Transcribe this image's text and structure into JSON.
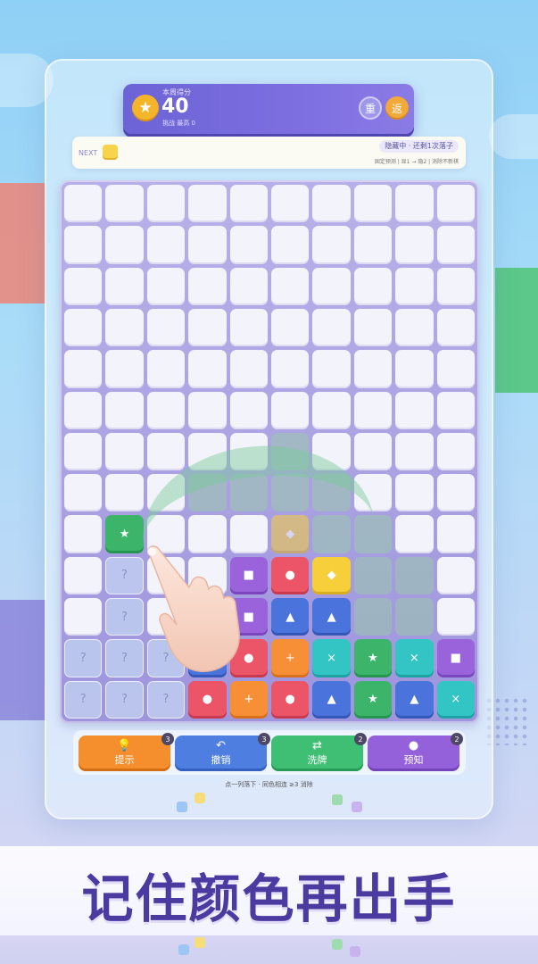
{
  "header": {
    "score_label": "本周得分",
    "score": "40",
    "sub": "挑战 最高 0",
    "restart_label": "重",
    "back_label": "返",
    "star_icon": "★"
  },
  "next": {
    "label": "NEXT",
    "chip_color": "yellow",
    "hidden_status": "隐藏中 · 还剩1次落子",
    "rules": "固定预测 | 显1 → 隐2 | 消除不新棋"
  },
  "board": {
    "cols": 10,
    "rows": 13,
    "grid": [
      "..........",
      "..........",
      "..........",
      "..........",
      "..........",
      "..........",
      ".....g....",
      "....ggg...",
      ".G..gYgg..",
      ".?..PRYgg.",
      ".?..PBBgg.",
      "???BRO CGCP",
      "???ROR BGBC"
    ],
    "cells": [
      {
        "r": 8,
        "c": 1,
        "color": "green",
        "sym": "★"
      },
      {
        "r": 8,
        "c": 5,
        "color": "yellow",
        "sym": "◆",
        "ghost": true
      },
      {
        "r": 9,
        "c": 1,
        "color": "hidden",
        "sym": "?"
      },
      {
        "r": 9,
        "c": 4,
        "color": "purple",
        "sym": "■"
      },
      {
        "r": 9,
        "c": 5,
        "color": "red",
        "sym": "●"
      },
      {
        "r": 9,
        "c": 6,
        "color": "yellow",
        "sym": "◆"
      },
      {
        "r": 10,
        "c": 1,
        "color": "hidden",
        "sym": "?"
      },
      {
        "r": 10,
        "c": 4,
        "color": "purple",
        "sym": "■"
      },
      {
        "r": 10,
        "c": 5,
        "color": "blue",
        "sym": "▲"
      },
      {
        "r": 10,
        "c": 6,
        "color": "blue",
        "sym": "▲"
      },
      {
        "r": 11,
        "c": 0,
        "color": "hidden",
        "sym": "?"
      },
      {
        "r": 11,
        "c": 1,
        "color": "hidden",
        "sym": "?"
      },
      {
        "r": 11,
        "c": 2,
        "color": "hidden",
        "sym": "?"
      },
      {
        "r": 11,
        "c": 3,
        "color": "blue",
        "sym": "▲"
      },
      {
        "r": 11,
        "c": 4,
        "color": "red",
        "sym": "●"
      },
      {
        "r": 11,
        "c": 5,
        "color": "orange",
        "sym": "+"
      },
      {
        "r": 11,
        "c": 6,
        "color": "cyan",
        "sym": "×"
      },
      {
        "r": 11,
        "c": 7,
        "color": "green",
        "sym": "★"
      },
      {
        "r": 11,
        "c": 8,
        "color": "cyan",
        "sym": "×"
      },
      {
        "r": 11,
        "c": 9,
        "color": "purple",
        "sym": "■"
      },
      {
        "r": 12,
        "c": 0,
        "color": "hidden",
        "sym": "?"
      },
      {
        "r": 12,
        "c": 1,
        "color": "hidden",
        "sym": "?"
      },
      {
        "r": 12,
        "c": 2,
        "color": "hidden",
        "sym": "?"
      },
      {
        "r": 12,
        "c": 3,
        "color": "red",
        "sym": "●"
      },
      {
        "r": 12,
        "c": 4,
        "color": "orange",
        "sym": "+"
      },
      {
        "r": 12,
        "c": 5,
        "color": "red",
        "sym": "●"
      },
      {
        "r": 12,
        "c": 6,
        "color": "blue",
        "sym": "▲"
      },
      {
        "r": 12,
        "c": 7,
        "color": "green",
        "sym": "★"
      },
      {
        "r": 12,
        "c": 8,
        "color": "blue",
        "sym": "▲"
      },
      {
        "r": 12,
        "c": 9,
        "color": "cyan",
        "sym": "×"
      },
      {
        "r": 6,
        "c": 5,
        "color": "ghost",
        "sym": ""
      },
      {
        "r": 7,
        "c": 3,
        "color": "ghost",
        "sym": ""
      },
      {
        "r": 7,
        "c": 4,
        "color": "ghost",
        "sym": ""
      },
      {
        "r": 7,
        "c": 5,
        "color": "ghost",
        "sym": ""
      },
      {
        "r": 7,
        "c": 6,
        "color": "ghost",
        "sym": ""
      },
      {
        "r": 8,
        "c": 6,
        "color": "ghost",
        "sym": ""
      },
      {
        "r": 8,
        "c": 7,
        "color": "ghost",
        "sym": ""
      },
      {
        "r": 9,
        "c": 7,
        "color": "ghost",
        "sym": ""
      },
      {
        "r": 9,
        "c": 8,
        "color": "ghost",
        "sym": ""
      },
      {
        "r": 10,
        "c": 7,
        "color": "ghost",
        "sym": ""
      },
      {
        "r": 10,
        "c": 8,
        "color": "ghost",
        "sym": ""
      }
    ]
  },
  "tools": [
    {
      "label": "提示",
      "icon": "lightbulb-icon",
      "glyph": "💡",
      "count": "3"
    },
    {
      "label": "撤销",
      "icon": "undo-icon",
      "glyph": "↶",
      "count": "3"
    },
    {
      "label": "洗牌",
      "icon": "shuffle-icon",
      "glyph": "⇄",
      "count": "2"
    },
    {
      "label": "预知",
      "icon": "crystal-ball-icon",
      "glyph": "●",
      "count": "2"
    }
  ],
  "tip": "点一列落下 · 同色相连 ≥3 消除",
  "slogan": "记住颜色再出手"
}
